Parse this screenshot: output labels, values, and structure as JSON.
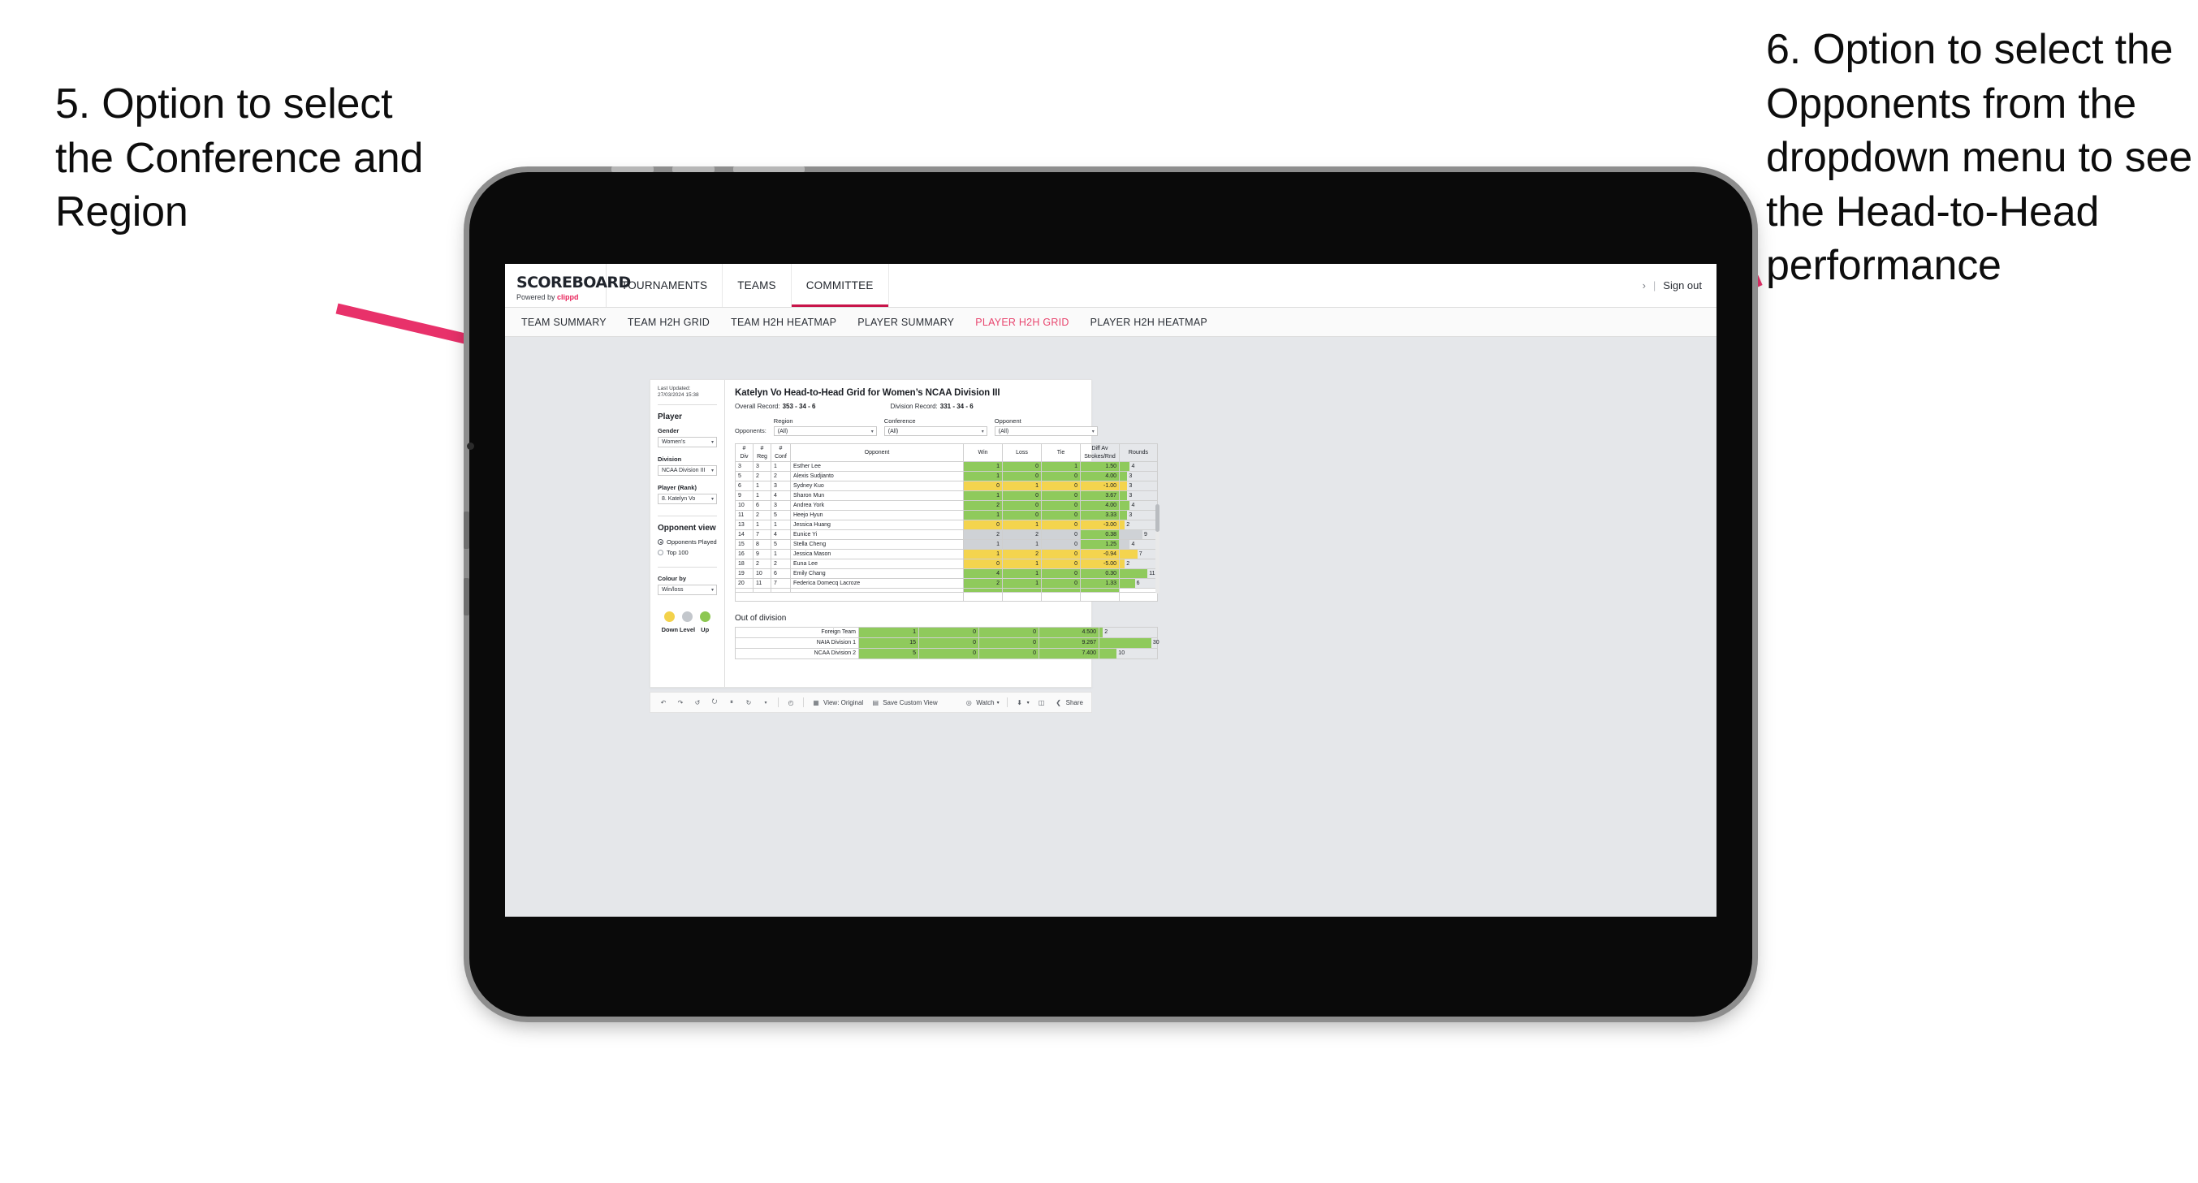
{
  "annotations": {
    "left": "5. Option to select the Conference and Region",
    "right": "6. Option to select the Opponents from the dropdown menu to see the Head-to-Head performance",
    "arrow_color": "#E8316A"
  },
  "app": {
    "brand": {
      "title": "SCOREBOARD",
      "powered_prefix": "Powered by ",
      "powered_brand": "clippd"
    },
    "nav": [
      {
        "label": "TOURNAMENTS",
        "active": false
      },
      {
        "label": "TEAMS",
        "active": false
      },
      {
        "label": "COMMITTEE",
        "active": true
      }
    ],
    "nav_right": {
      "chevron": "›",
      "divider": "|",
      "signout": "Sign out"
    },
    "subtabs": [
      {
        "label": "TEAM SUMMARY",
        "active": false
      },
      {
        "label": "TEAM H2H GRID",
        "active": false
      },
      {
        "label": "TEAM H2H HEATMAP",
        "active": false
      },
      {
        "label": "PLAYER SUMMARY",
        "active": false
      },
      {
        "label": "PLAYER H2H GRID",
        "active": true
      },
      {
        "label": "PLAYER H2H HEATMAP",
        "active": false
      }
    ]
  },
  "sidebar": {
    "last_updated": "Last Updated: 27/03/2024 15:38",
    "section_title": "Player",
    "fields": [
      {
        "label": "Gender",
        "value": "Women’s"
      },
      {
        "label": "Division",
        "value": "NCAA Division III"
      },
      {
        "label": "Player (Rank)",
        "value": "8. Katelyn Vo"
      }
    ],
    "opponent_view": {
      "title": "Opponent view",
      "options": [
        {
          "label": "Opponents Played",
          "selected": true
        },
        {
          "label": "Top 100",
          "selected": false
        }
      ]
    },
    "colour_by": {
      "label": "Colour by",
      "value": "Win/loss"
    },
    "legend": [
      {
        "label": "Down",
        "color": "#F3D24B"
      },
      {
        "label": "Level",
        "color": "#C3C7CC"
      },
      {
        "label": "Up",
        "color": "#8CC751"
      }
    ]
  },
  "sheet": {
    "title": "Katelyn Vo Head-to-Head Grid for Women’s NCAA Division III",
    "overall_record_label": "Overall Record:",
    "overall_record_value": "353 -  34 - 6",
    "division_record_label": "Division Record:",
    "division_record_value": "331 -  34 - 6",
    "opponents_label": "Opponents:",
    "filters": [
      {
        "label": "Region",
        "value": "(All)"
      },
      {
        "label": "Conference",
        "value": "(All)"
      },
      {
        "label": "Opponent",
        "value": "(All)"
      }
    ]
  },
  "chart_data": {
    "type": "table",
    "title": "Katelyn Vo Head-to-Head Grid for Women’s NCAA Division III",
    "columns": [
      "# Div",
      "# Reg",
      "# Conf",
      "Opponent",
      "Win",
      "Loss",
      "Tie",
      "Diff Av Strokes/Rnd",
      "Rounds"
    ],
    "column_headers_multiline": [
      [
        "#",
        "Div"
      ],
      [
        "#",
        "Reg"
      ],
      [
        "#",
        "Conf"
      ],
      [
        "Opponent"
      ],
      [
        "Win"
      ],
      [
        "Loss"
      ],
      [
        "Tie"
      ],
      [
        "Diff Av",
        "Strokes/Rnd"
      ],
      [
        "Rounds"
      ]
    ],
    "rounds_max": 30,
    "rows": [
      {
        "div": "3",
        "reg": "3",
        "conf": "1",
        "opponent": "Esther Lee",
        "win": "1",
        "loss": "0",
        "tie": "1",
        "diff": "1.50",
        "rounds": "4",
        "state": "up"
      },
      {
        "div": "5",
        "reg": "2",
        "conf": "2",
        "opponent": "Alexis Sudjianto",
        "win": "1",
        "loss": "0",
        "tie": "0",
        "diff": "4.00",
        "rounds": "3",
        "state": "up"
      },
      {
        "div": "6",
        "reg": "1",
        "conf": "3",
        "opponent": "Sydney Kuo",
        "win": "0",
        "loss": "1",
        "tie": "0",
        "diff": "-1.00",
        "rounds": "3",
        "state": "down"
      },
      {
        "div": "9",
        "reg": "1",
        "conf": "4",
        "opponent": "Sharon Mun",
        "win": "1",
        "loss": "0",
        "tie": "0",
        "diff": "3.67",
        "rounds": "3",
        "state": "up"
      },
      {
        "div": "10",
        "reg": "6",
        "conf": "3",
        "opponent": "Andrea York",
        "win": "2",
        "loss": "0",
        "tie": "0",
        "diff": "4.00",
        "rounds": "4",
        "state": "up"
      },
      {
        "div": "11",
        "reg": "2",
        "conf": "5",
        "opponent": "Heejo Hyun",
        "win": "1",
        "loss": "0",
        "tie": "0",
        "diff": "3.33",
        "rounds": "3",
        "state": "up"
      },
      {
        "div": "13",
        "reg": "1",
        "conf": "1",
        "opponent": "Jessica Huang",
        "win": "0",
        "loss": "1",
        "tie": "0",
        "diff": "-3.00",
        "rounds": "2",
        "state": "down"
      },
      {
        "div": "14",
        "reg": "7",
        "conf": "4",
        "opponent": "Eunice Yi",
        "win": "2",
        "loss": "2",
        "tie": "0",
        "diff": "0.38",
        "rounds": "9",
        "state": "level",
        "diff_state": "up"
      },
      {
        "div": "15",
        "reg": "8",
        "conf": "5",
        "opponent": "Stella Cheng",
        "win": "1",
        "loss": "1",
        "tie": "0",
        "diff": "1.25",
        "rounds": "4",
        "state": "level",
        "diff_state": "up"
      },
      {
        "div": "16",
        "reg": "9",
        "conf": "1",
        "opponent": "Jessica Mason",
        "win": "1",
        "loss": "2",
        "tie": "0",
        "diff": "-0.94",
        "rounds": "7",
        "state": "down"
      },
      {
        "div": "18",
        "reg": "2",
        "conf": "2",
        "opponent": "Euna Lee",
        "win": "0",
        "loss": "1",
        "tie": "0",
        "diff": "-5.00",
        "rounds": "2",
        "state": "down"
      },
      {
        "div": "19",
        "reg": "10",
        "conf": "6",
        "opponent": "Emily Chang",
        "win": "4",
        "loss": "1",
        "tie": "0",
        "diff": "0.30",
        "rounds": "11",
        "state": "up"
      },
      {
        "div": "20",
        "reg": "11",
        "conf": "7",
        "opponent": "Federica Domecq Lacroze",
        "win": "2",
        "loss": "1",
        "tie": "0",
        "diff": "1.33",
        "rounds": "6",
        "state": "up"
      }
    ],
    "out_of_division": {
      "title": "Out of division",
      "rows": [
        {
          "name": "Foreign Team",
          "win": "1",
          "loss": "0",
          "tie": "0",
          "diff": "4.500",
          "rounds": "2",
          "state": "up"
        },
        {
          "name": "NAIA Division 1",
          "win": "15",
          "loss": "0",
          "tie": "0",
          "diff": "9.267",
          "rounds": "30",
          "state": "up"
        },
        {
          "name": "NCAA Division 2",
          "win": "5",
          "loss": "0",
          "tie": "0",
          "diff": "7.400",
          "rounds": "10",
          "state": "up"
        }
      ]
    }
  },
  "toolbar": {
    "items": [
      {
        "name": "undo",
        "glyph": "↶"
      },
      {
        "name": "redo",
        "glyph": "↷"
      },
      {
        "name": "revert",
        "glyph": "↺"
      },
      {
        "name": "refresh",
        "glyph": "⭮"
      },
      {
        "name": "pause",
        "glyph": "⏸"
      },
      {
        "name": "clear-sheet",
        "glyph": "↻"
      },
      {
        "name": "clear-caret",
        "glyph": "▾"
      }
    ],
    "history_glyph": "◴",
    "view_original": "View: Original",
    "save_custom_view": "Save Custom View",
    "watch": "Watch",
    "watch_caret": "▾",
    "download_caret": "▾",
    "share": "Share"
  }
}
